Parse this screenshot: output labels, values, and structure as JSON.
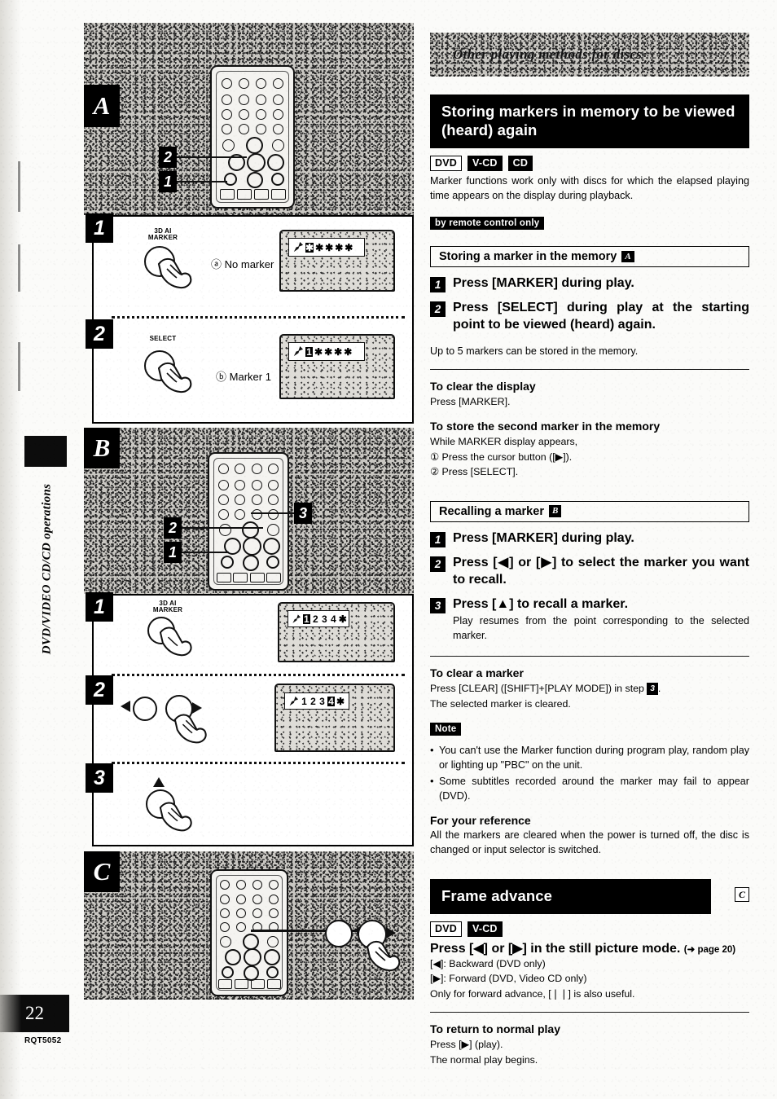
{
  "page": {
    "number": "22",
    "doc_code": "RQT5052",
    "side_tab": "DVD/VIDEO CD/CD operations"
  },
  "right": {
    "chapter_banner": "Other playing methods for discs",
    "section1": {
      "title": "Storing markers in memory to be viewed (heard) again",
      "discs": [
        {
          "label": "DVD",
          "style": "out"
        },
        {
          "label": "V-CD",
          "style": "inv"
        },
        {
          "label": "CD",
          "style": "inv"
        }
      ],
      "intro": "Marker functions work only with discs for which the elapsed playing time appears on the display during playback.",
      "remote_tag": "by remote control only",
      "sub1": {
        "heading": "Storing a marker in the memory",
        "badge": "A",
        "steps": [
          {
            "num": "1",
            "text": "Press [MARKER] during play."
          },
          {
            "num": "2",
            "text": "Press [SELECT] during play at the starting point to be viewed (heard) again."
          }
        ],
        "after": "Up to 5 markers can be stored in the memory.",
        "blocks": [
          {
            "heading": "To clear the display",
            "lines": [
              "Press [MARKER]."
            ]
          },
          {
            "heading": "To store the second marker in the memory",
            "lines": [
              "While MARKER display appears,",
              "① Press the cursor button ([▶]).",
              "② Press [SELECT]."
            ]
          }
        ]
      },
      "sub2": {
        "heading": "Recalling a marker",
        "badge": "B",
        "steps": [
          {
            "num": "1",
            "text": "Press [MARKER] during play.",
            "sub": ""
          },
          {
            "num": "2",
            "text": "Press [◀] or [▶] to select the marker you want to recall.",
            "sub": ""
          },
          {
            "num": "3",
            "text": "Press [▲] to recall a marker.",
            "sub": "Play resumes from the point corresponding to the selected marker."
          }
        ],
        "clear": {
          "heading": "To clear a marker",
          "line1_pre": "Press [CLEAR] ([SHIFT]+[PLAY MODE]) in step ",
          "line1_step": "3",
          "line1_post": ".",
          "line2": "The selected marker is cleared."
        },
        "note_tag": "Note",
        "notes": [
          "You can't use the Marker function during program play, random play or lighting up \"PBC\" on the unit.",
          "Some subtitles recorded around the marker may fail to appear (DVD)."
        ],
        "reference": {
          "heading": "For your reference",
          "text": "All the markers are cleared when the power is turned off, the disc is changed or input selector is switched."
        }
      }
    },
    "section2": {
      "title": "Frame advance",
      "badge": "C",
      "discs": [
        {
          "label": "DVD",
          "style": "out"
        },
        {
          "label": "V-CD",
          "style": "inv"
        }
      ],
      "main_instruction": "Press [◀] or [▶] in the still picture mode.",
      "page_ref": "(➜ page 20)",
      "details": [
        "[◀]: Backward (DVD only)",
        "[▶]: Forward (DVD, Video CD only)",
        "Only for forward advance, [❘❘] is also useful."
      ],
      "return": {
        "heading": "To return to normal play",
        "lines": [
          "Press [▶] (play).",
          "The normal play begins."
        ]
      }
    }
  },
  "left": {
    "panelA": {
      "letter": "A",
      "callouts": [
        "2",
        "1"
      ],
      "steps": [
        {
          "chip": "1",
          "button_label": "3D AI\nMARKER",
          "callout_mark": "ⓐ",
          "callout_text": "No marker",
          "osd": {
            "marker_icon": "📍",
            "cells": [
              "✱",
              "✱",
              "✱",
              "✱",
              "✱"
            ],
            "highlight_index": 0
          }
        },
        {
          "chip": "2",
          "button_label": "SELECT",
          "callout_mark": "ⓑ",
          "callout_text": "Marker 1",
          "osd": {
            "marker_icon": "📍",
            "cells": [
              "1",
              "✱",
              "✱",
              "✱",
              "✱"
            ],
            "highlight_index": 0
          }
        }
      ]
    },
    "panelB": {
      "letter": "B",
      "callouts": [
        "3",
        "2",
        "1"
      ],
      "steps": [
        {
          "chip": "1",
          "button_label": "3D AI\nMARKER",
          "osd": {
            "marker_icon": "📍",
            "cells": [
              "1",
              "2",
              "3",
              "4",
              "✱"
            ],
            "highlight_index": 0
          }
        },
        {
          "chip": "2",
          "button_label": "",
          "osd": {
            "marker_icon": "📍",
            "cells": [
              "1",
              "2",
              "3",
              "4",
              "✱"
            ],
            "highlight_index": 3
          }
        },
        {
          "chip": "3",
          "button_label": "",
          "osd": null
        }
      ]
    },
    "panelC": {
      "letter": "C"
    }
  }
}
